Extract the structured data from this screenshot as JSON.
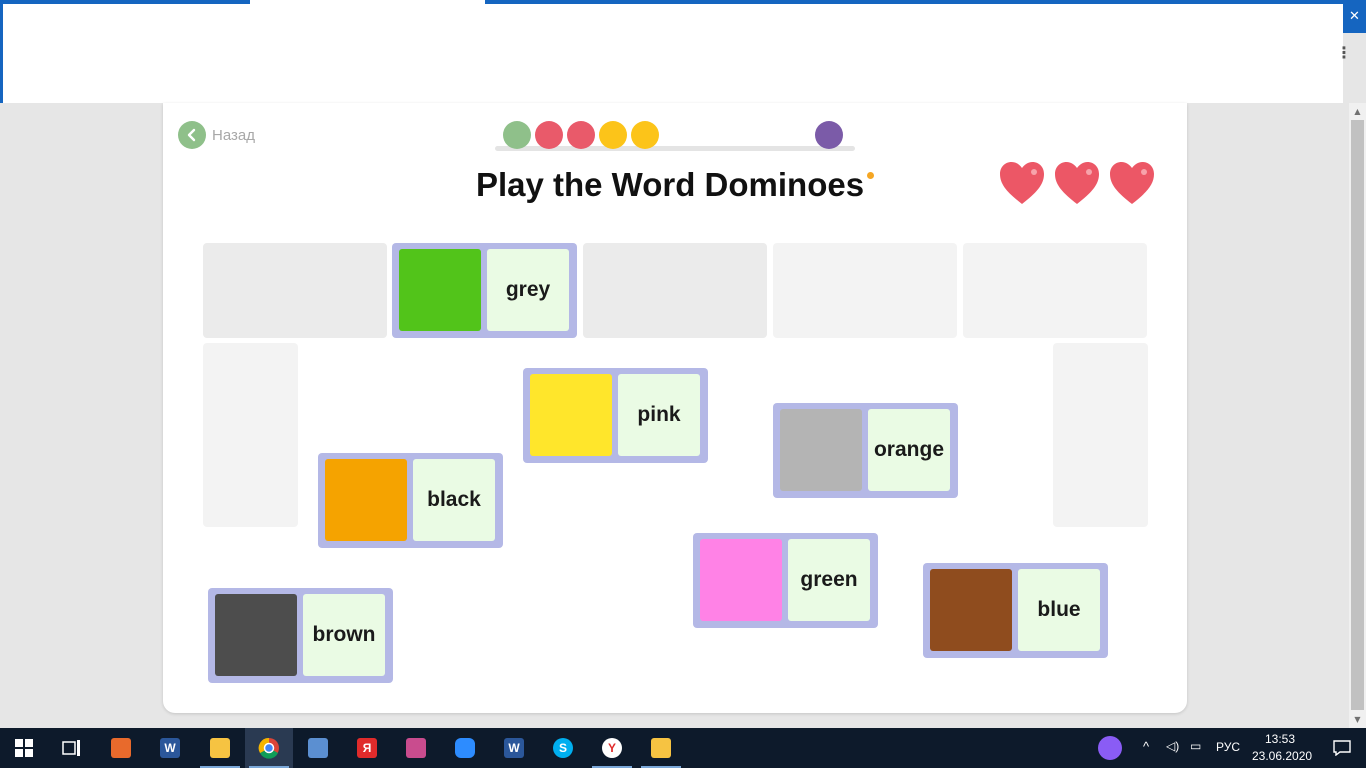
{
  "browser": {
    "close_glyph": "✕",
    "menu_glyph": "⋮"
  },
  "scrollbar": {
    "up_glyph": "▲",
    "down_glyph": "▼"
  },
  "game": {
    "back_label": "Назад",
    "back_icon": "chevron-left-icon",
    "title": "Play the Word Dominoes",
    "progress_dots": [
      {
        "color": "#8fc08a"
      },
      {
        "color": "#e95a6a"
      },
      {
        "color": "#e95a6a"
      },
      {
        "color": "#fcc419"
      },
      {
        "color": "#fcc419"
      }
    ],
    "progress_end_dot_color": "#7b5ba8",
    "lives": 3,
    "heart_color": "#ec5766",
    "dominoes": [
      {
        "id": "grey",
        "word": "grey",
        "swatch": "#52c41a",
        "placed": true
      },
      {
        "id": "pink",
        "word": "pink",
        "swatch": "#ffe62b",
        "placed": false
      },
      {
        "id": "orange",
        "word": "orange",
        "swatch": "#b4b4b4",
        "placed": false
      },
      {
        "id": "black",
        "word": "black",
        "swatch": "#f5a300",
        "placed": false
      },
      {
        "id": "green",
        "word": "green",
        "swatch": "#ff82e6",
        "placed": false
      },
      {
        "id": "blue",
        "word": "blue",
        "swatch": "#8f4c1e",
        "placed": false
      },
      {
        "id": "brown",
        "word": "brown",
        "swatch": "#4d4d4d",
        "placed": false
      }
    ]
  },
  "taskbar": {
    "apps": [
      {
        "name": "start-icon"
      },
      {
        "name": "task-view-icon"
      },
      {
        "name": "presentation-app-icon"
      },
      {
        "name": "word-app-icon",
        "label": "W"
      },
      {
        "name": "file-explorer-icon"
      },
      {
        "name": "chrome-icon"
      },
      {
        "name": "document-app-icon"
      },
      {
        "name": "yandex-icon",
        "label": "Я"
      },
      {
        "name": "sign-app-icon"
      },
      {
        "name": "zoom-icon"
      },
      {
        "name": "word-app-icon-2",
        "label": "W"
      },
      {
        "name": "skype-icon",
        "label": "S"
      },
      {
        "name": "yandex-browser-icon",
        "label": "Y"
      },
      {
        "name": "mail-icon"
      }
    ],
    "language": "РУС",
    "time": "13:53",
    "date": "23.06.2020"
  }
}
